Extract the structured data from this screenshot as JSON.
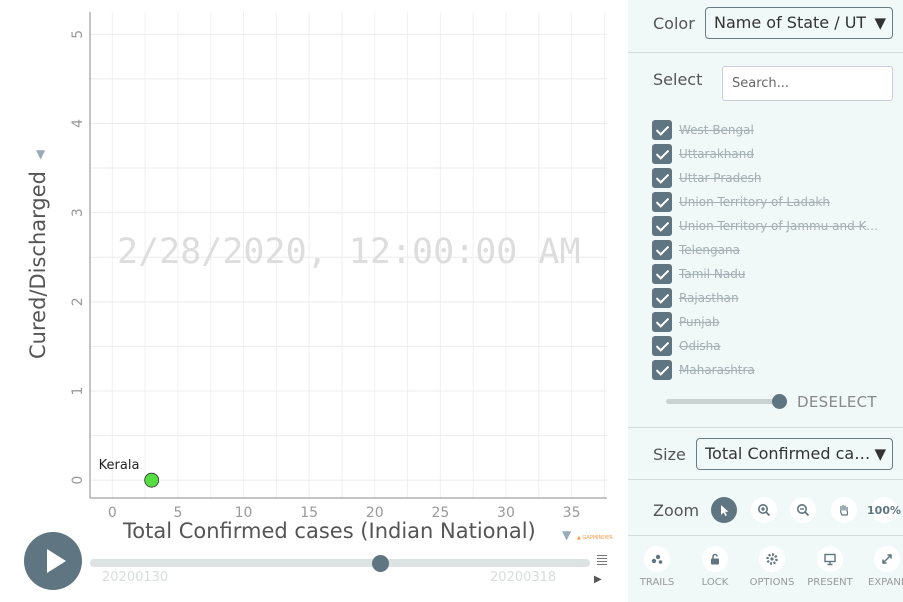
{
  "chart_data": {
    "type": "scatter",
    "title": "",
    "xlabel": "Total Confirmed cases (Indian National)",
    "ylabel": "Cured/Discharged",
    "xlim": [
      -1.7,
      37.7
    ],
    "ylim": [
      -0.2,
      5.25
    ],
    "xticks": [
      0,
      5,
      10,
      15,
      20,
      25,
      30,
      35
    ],
    "yticks": [
      0,
      1,
      2,
      3,
      4,
      5
    ],
    "grid": true,
    "points": [
      {
        "label": "Kerala",
        "x": 3,
        "y": 0,
        "color": "#55dd44"
      }
    ]
  },
  "timestamp": "2/28/2020, 12:00:00 AM",
  "controls": {
    "timeline_start": "20200130",
    "timeline_end": "20200318",
    "credit": "▲ GAPMINDER",
    "play_progress": 0.58
  },
  "panel": {
    "color_label": "Color",
    "color_value": "Name of State / UT",
    "select_label": "Select",
    "search_placeholder": "Search...",
    "states": [
      "West Bengal",
      "Uttarakhand",
      "Uttar Pradesh",
      "Union Territory of Ladakh",
      "Union Territory of Jammu and Kashmir",
      "Telengana",
      "Tamil Nadu",
      "Rajasthan",
      "Punjab",
      "Odisha",
      "Maharashtra"
    ],
    "deselect_label": "DESELECT",
    "size_label": "Size",
    "size_value": "Total Confirmed cases (Indian National)",
    "zoom_label": "Zoom",
    "zoom_percent": "100%",
    "tools": [
      "TRAILS",
      "LOCK",
      "OPTIONS",
      "PRESENT",
      "EXPAND"
    ]
  },
  "colors": {
    "accent": "#5f7581",
    "panel_bg": "#f0f8f8",
    "bubble": "#55dd44"
  }
}
